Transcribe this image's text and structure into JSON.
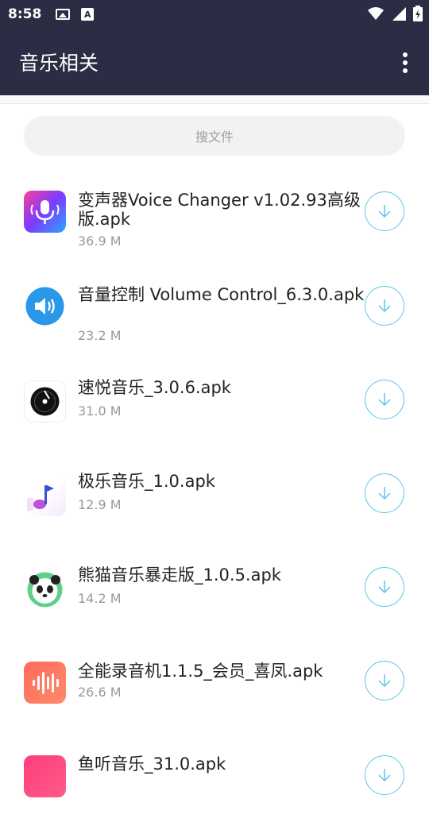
{
  "status_bar": {
    "time": "8:58",
    "image_icon": "image-icon",
    "a_icon_label": "A"
  },
  "app_bar": {
    "title": "音乐相关",
    "menu_icon": "more-vert-icon"
  },
  "search": {
    "placeholder": "搜文件"
  },
  "files": [
    {
      "name": "变声器Voice Changer v1.02.93高级版.apk",
      "size": "36.9 M",
      "icon": "voice-changer-icon"
    },
    {
      "name": "音量控制 Volume Control_6.3.0.apk",
      "size": "23.2 M",
      "icon": "volume-icon"
    },
    {
      "name": "速悦音乐_3.0.6.apk",
      "size": "31.0 M",
      "icon": "music-disc-icon"
    },
    {
      "name": "极乐音乐_1.0.apk",
      "size": "12.9 M",
      "icon": "music-note-icon"
    },
    {
      "name": "熊猫音乐暴走版_1.0.5.apk",
      "size": "14.2 M",
      "icon": "panda-icon"
    },
    {
      "name": "全能录音机1.1.5_会员_喜凤.apk",
      "size": "26.6 M",
      "icon": "audio-wave-icon"
    },
    {
      "name": "鱼听音乐_31.0.apk",
      "size": "",
      "icon": "fish-music-icon"
    }
  ],
  "colors": {
    "app_bar": "#2c2c44",
    "accent": "#5cc6e8"
  }
}
